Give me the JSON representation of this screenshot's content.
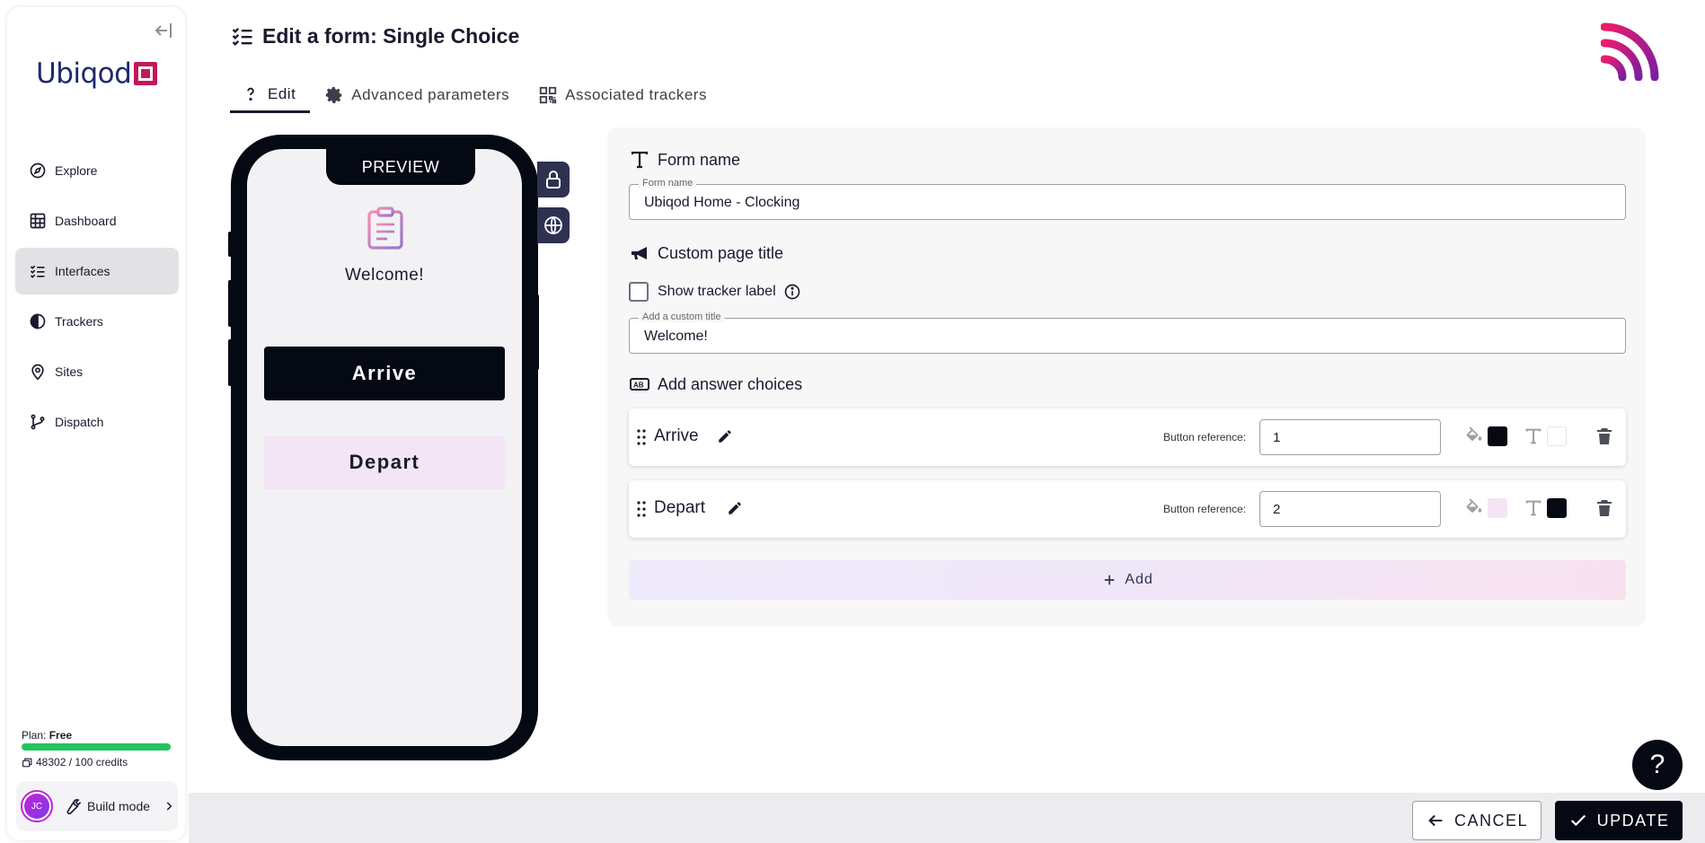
{
  "brand": {
    "name": "Ubiqod"
  },
  "sidebar": {
    "items": [
      {
        "label": "Explore"
      },
      {
        "label": "Dashboard"
      },
      {
        "label": "Interfaces"
      },
      {
        "label": "Trackers"
      },
      {
        "label": "Sites"
      },
      {
        "label": "Dispatch"
      }
    ],
    "plan_prefix": "Plan:",
    "plan_name": "Free",
    "credits": "48302 / 100 credits",
    "avatar_initials": "JC",
    "build_mode": "Build mode"
  },
  "header": {
    "title": "Edit a form: Single Choice",
    "tabs": [
      {
        "label": "Edit"
      },
      {
        "label": "Advanced parameters"
      },
      {
        "label": "Associated trackers"
      }
    ]
  },
  "preview": {
    "label": "PREVIEW",
    "welcome": "Welcome!",
    "choices": [
      {
        "label": "Arrive",
        "bg": "#050914",
        "fg": "#ffffff"
      },
      {
        "label": "Depart",
        "bg": "#f3e5f5",
        "fg": "#1a1a2e"
      }
    ]
  },
  "form": {
    "form_name_section": "Form name",
    "form_name_label": "Form name",
    "form_name_value": "Ubiqod Home - Clocking",
    "custom_title_section": "Custom page title",
    "show_tracker_label": "Show tracker label",
    "show_tracker_checked": false,
    "custom_title_label": "Add a custom title",
    "custom_title_value": "Welcome!",
    "answers_section": "Add answer choices",
    "button_reference_label": "Button reference:",
    "choices": [
      {
        "name": "Arrive",
        "reference": "1",
        "bg_color": "#050914",
        "text_color": "#ffffff"
      },
      {
        "name": "Depart",
        "reference": "2",
        "bg_color": "#f3e5f5",
        "text_color": "#050914"
      }
    ],
    "add_label": "Add"
  },
  "footer": {
    "cancel": "CANCEL",
    "update": "UPDATE"
  },
  "help": {
    "label": "?"
  },
  "colors": {
    "accent_dark": "#050914",
    "brand_magenta": "#c2185b",
    "credit_bar": "#22c55e"
  }
}
